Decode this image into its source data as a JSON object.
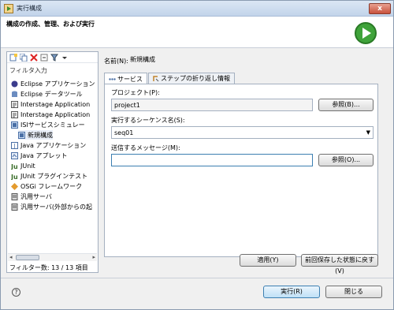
{
  "window": {
    "title": "実行構成",
    "close_label": "x"
  },
  "header": {
    "title": "構成の作成、管理、および実行"
  },
  "left": {
    "toolbar_icons": [
      "new-config-icon",
      "duplicate-icon",
      "delete-icon",
      "collapse-all-icon",
      "filter-icon",
      "dropdown-icon"
    ],
    "filter_placeholder": "フィルタ入力",
    "tree": [
      {
        "label": "Eclipse アプリケーション",
        "icon": "eclipse-icon",
        "indent": 0
      },
      {
        "label": "Eclipse データツール",
        "icon": "data-tool-icon",
        "indent": 0
      },
      {
        "label": "Interstage Application",
        "icon": "interstage-icon",
        "indent": 0
      },
      {
        "label": "Interstage Application",
        "icon": "interstage-icon",
        "indent": 0
      },
      {
        "label": "ISIサービスシミュレー",
        "icon": "isi-simulator-icon",
        "indent": 0
      },
      {
        "label": "新規構成",
        "icon": "config-icon",
        "indent": 1,
        "selected": true
      },
      {
        "label": "Java アプリケーション",
        "icon": "java-app-icon",
        "indent": 0
      },
      {
        "label": "Java アプレット",
        "icon": "java-applet-icon",
        "indent": 0
      },
      {
        "label": "JUnit",
        "icon": "junit-icon",
        "indent": 0
      },
      {
        "label": "JUnit プラグインテスト",
        "icon": "junit-plugin-icon",
        "indent": 0
      },
      {
        "label": "OSGi フレームワーク",
        "icon": "osgi-icon",
        "indent": 0
      },
      {
        "label": "汎用サーバ",
        "icon": "server-icon",
        "indent": 0
      },
      {
        "label": "汎用サーバ(外部からの起",
        "icon": "server-external-icon",
        "indent": 0
      }
    ],
    "filter_count": "フィルター数: 13 / 13 項目"
  },
  "right": {
    "name_label": "名前(N):",
    "name_value": "新規構成",
    "tabs": [
      {
        "label": "サービス",
        "icon": "service-icon",
        "active": true
      },
      {
        "label": "ステップの折り返し情報",
        "icon": "step-icon",
        "active": false
      }
    ],
    "project_label": "プロジェクト(P):",
    "project_value": "project1",
    "browse_label_1": "参照(B)...",
    "sequence_label": "実行するシーケンス名(S):",
    "sequence_value": "seq01",
    "message_label": "送信するメッセージ(M):",
    "message_value": "",
    "browse_label_2": "参照(O)...",
    "apply_label": "適用(Y)",
    "revert_label": "前回保存した状態に戻す(V)"
  },
  "footer": {
    "help_label": "?",
    "run_label": "実行(R)",
    "close_label": "閉じる"
  }
}
